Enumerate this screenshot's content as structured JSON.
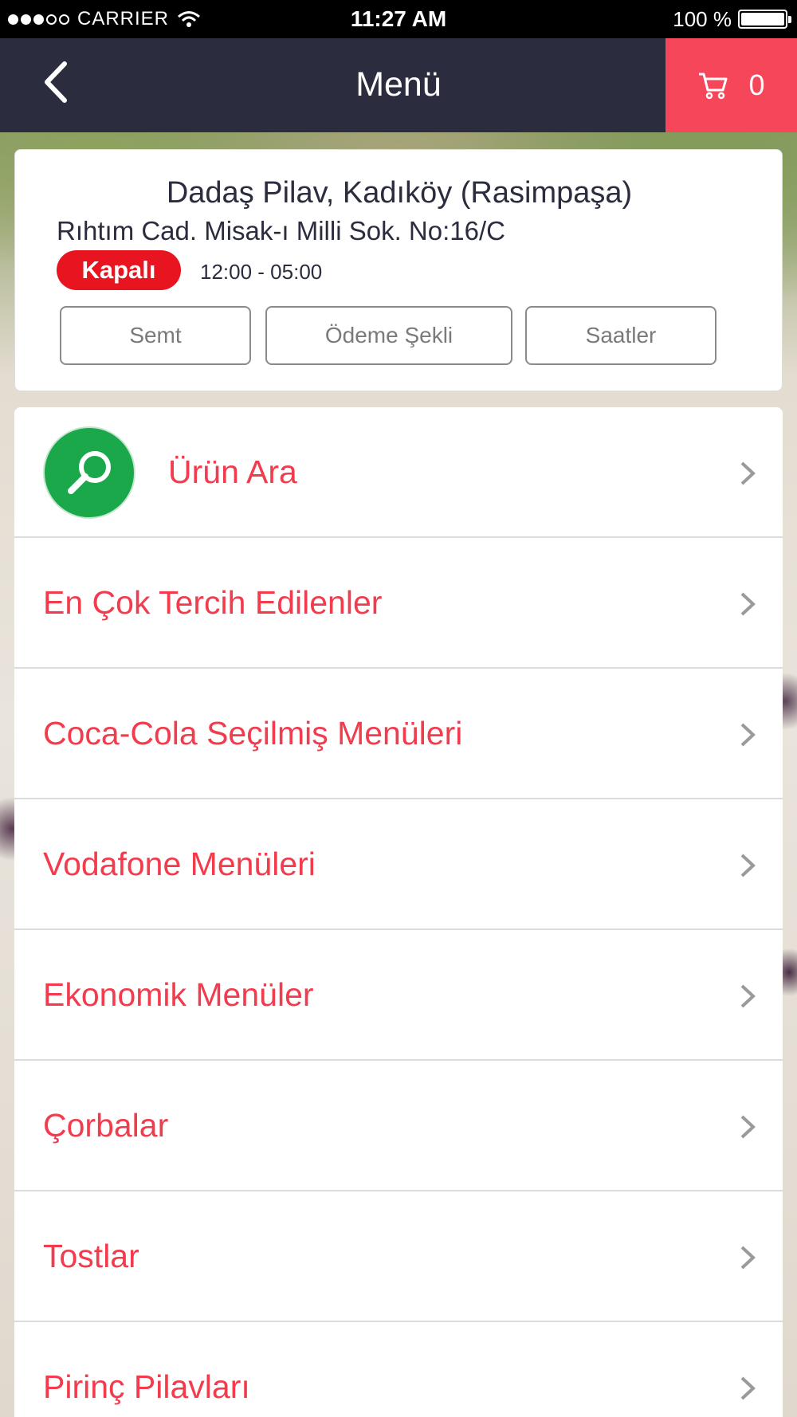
{
  "status_bar": {
    "carrier": "CARRIER",
    "time": "11:27 AM",
    "battery": "100 %",
    "signal_strength": 3
  },
  "nav": {
    "title": "Menü",
    "back_icon": "chevron-left-icon",
    "cart_icon": "cart-icon",
    "cart_count": "0",
    "cart_color": "#f5465a",
    "bar_color": "#2b2d3e"
  },
  "restaurant": {
    "name": "Dadaş Pilav, Kadıköy (Rasimpaşa)",
    "address": "Rıhtım Cad. Misak-ı Milli Sok. No:16/C",
    "status": "Kapalı",
    "status_color": "#e8141f",
    "hours": "12:00 - 05:00",
    "buttons": [
      "Semt",
      "Ödeme Şekli",
      "Saatler"
    ]
  },
  "menu": {
    "accent_color": "#f23c4e",
    "search_label": "Ürün Ara",
    "search_icon": "search-icon",
    "items": [
      "En Çok Tercih Edilenler",
      "Coca-Cola Seçilmiş Menüleri",
      "Vodafone Menüleri",
      "Ekonomik Menüler",
      "Çorbalar",
      "Tostlar",
      "Pirinç Pilavları"
    ]
  }
}
